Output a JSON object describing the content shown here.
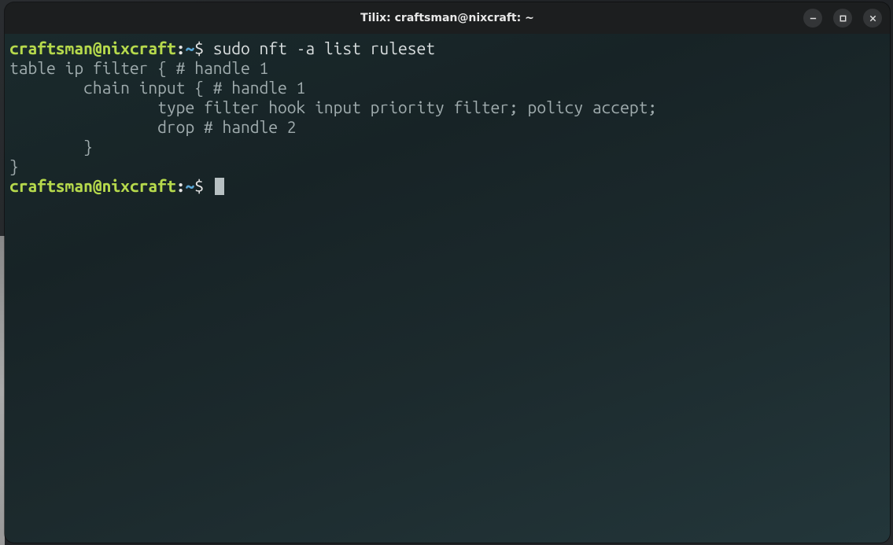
{
  "window": {
    "title": "Tilix: craftsman@nixcraft: ~"
  },
  "prompt": {
    "user_host": "craftsman@nixcraft",
    "colon": ":",
    "path": "~",
    "dollar": "$"
  },
  "session": {
    "command1": "sudo nft -a list ruleset",
    "output_lines": [
      "table ip filter { # handle 1",
      "        chain input { # handle 1",
      "                type filter hook input priority filter; policy accept;",
      "                drop # handle 2",
      "        }",
      "}"
    ]
  }
}
